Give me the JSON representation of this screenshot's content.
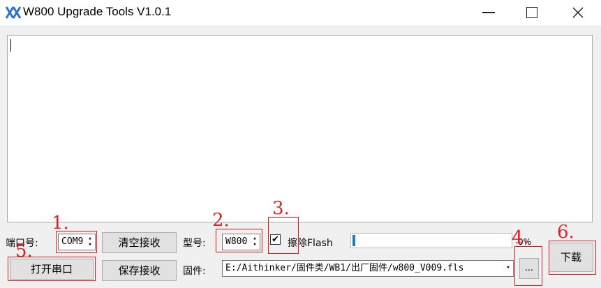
{
  "window": {
    "title": "W800 Upgrade Tools V1.0.1"
  },
  "output": {
    "text": ""
  },
  "port": {
    "label": "端口号:",
    "value": "COM9",
    "open_button": "打开串口"
  },
  "receive": {
    "clear_button": "清空接收",
    "save_button": "保存接收"
  },
  "model": {
    "label": "型号:",
    "value": "W800"
  },
  "erase": {
    "label": "擦除Flash",
    "checked": true
  },
  "progress": {
    "percent": 0,
    "text": "0%"
  },
  "firmware": {
    "label": "固件:",
    "path": "E:/Aithinker/固件类/WB1/出厂固件/w800_V009.fls",
    "browse_button": "..."
  },
  "download": {
    "button": "下载"
  },
  "annotations": {
    "n1": "1.",
    "n2": "2.",
    "n3": "3.",
    "n4": "4.",
    "n5": "5.",
    "n6": "6.",
    "color": "#e02020"
  }
}
